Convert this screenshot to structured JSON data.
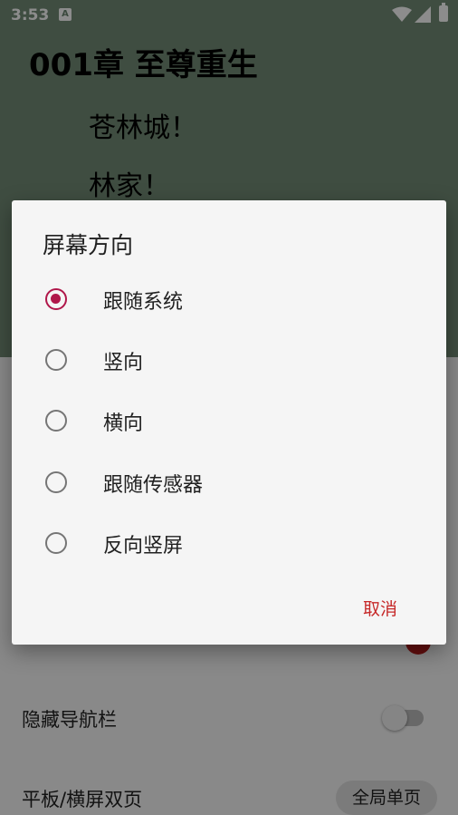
{
  "status_bar": {
    "time": "3:53",
    "app_icon_letter": "A"
  },
  "reader": {
    "chapter_title": "001章 至尊重生",
    "paragraphs": [
      "苍林城！",
      "林家！"
    ]
  },
  "settings": {
    "row_hide_nav": "隐藏导航栏",
    "row_tablet": "平板/横屏双页",
    "tablet_chip": "全局单页"
  },
  "dialog": {
    "title": "屏幕方向",
    "options": [
      {
        "label": "跟随系统",
        "selected": true
      },
      {
        "label": "竖向",
        "selected": false
      },
      {
        "label": "横向",
        "selected": false
      },
      {
        "label": "跟随传感器",
        "selected": false
      },
      {
        "label": "反向竖屏",
        "selected": false
      }
    ],
    "cancel_label": "取消"
  },
  "colors": {
    "accent": "#b0174a",
    "cancel": "#c62828"
  }
}
